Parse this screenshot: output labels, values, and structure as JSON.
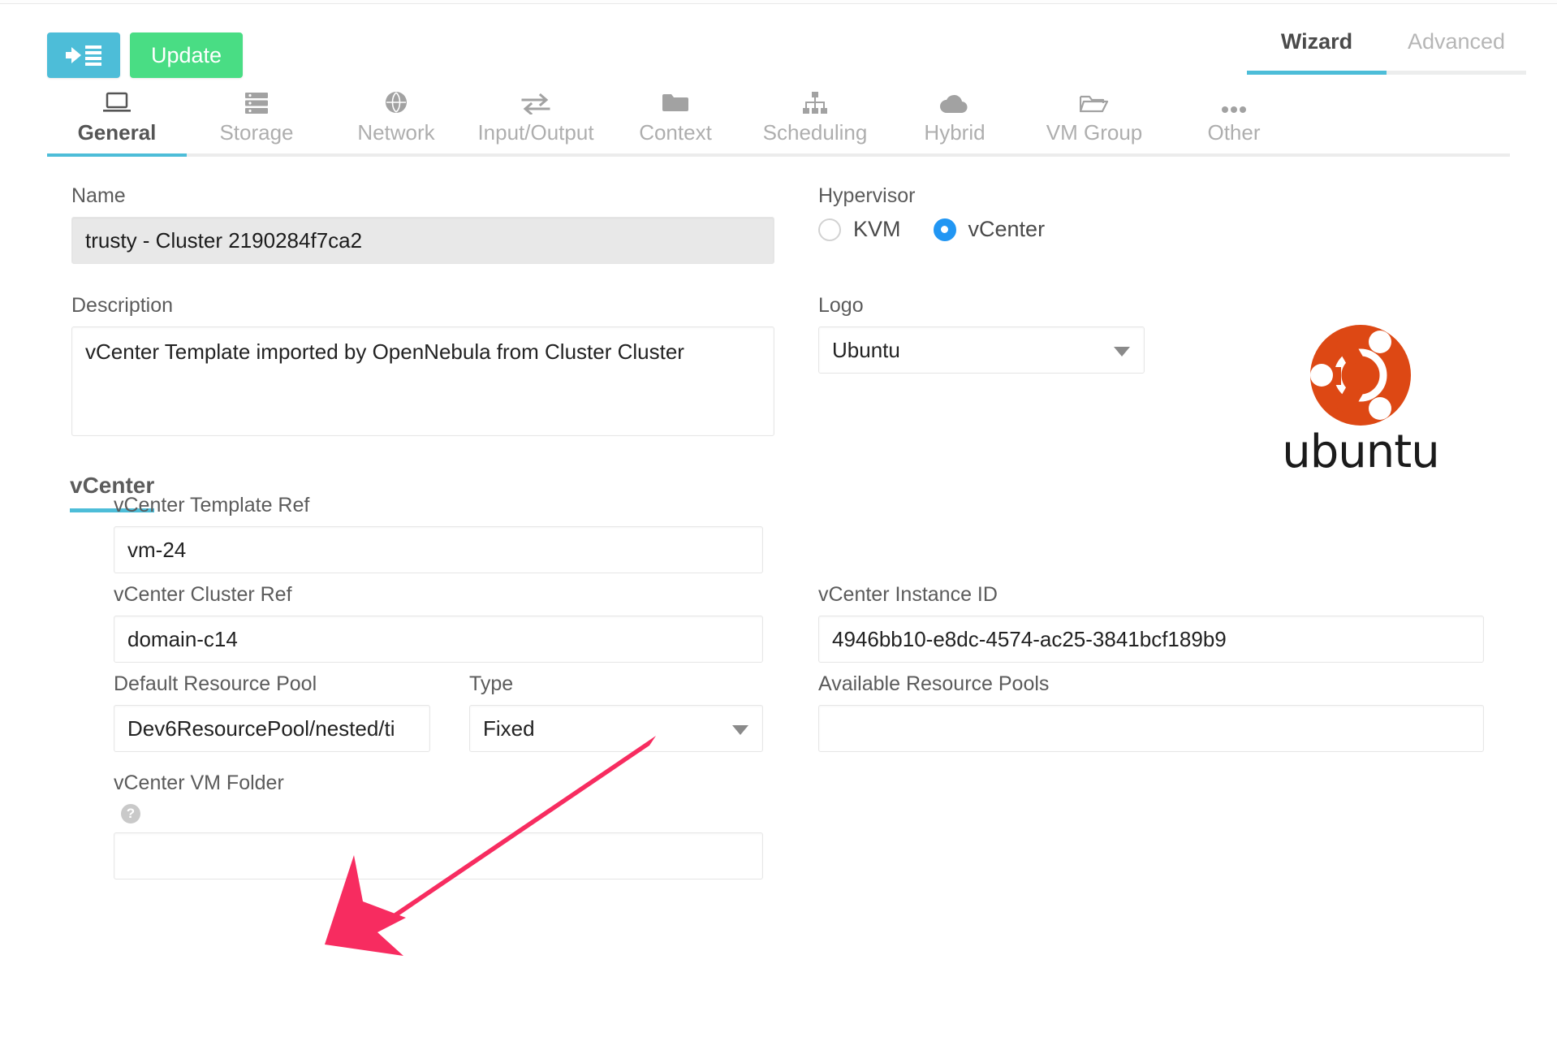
{
  "header": {
    "back_icon": "back-list-icon",
    "update_label": "Update",
    "back_color": "#4dbdd8",
    "update_color": "#49dd84"
  },
  "mode_tabs": [
    {
      "label": "Wizard",
      "active": true
    },
    {
      "label": "Advanced",
      "active": false
    }
  ],
  "tabs": [
    {
      "label": "General",
      "icon": "laptop-icon",
      "active": true
    },
    {
      "label": "Storage",
      "icon": "storage-icon",
      "active": false
    },
    {
      "label": "Network",
      "icon": "globe-icon",
      "active": false
    },
    {
      "label": "Input/Output",
      "icon": "exchange-icon",
      "active": false
    },
    {
      "label": "Context",
      "icon": "folder-icon",
      "active": false
    },
    {
      "label": "Scheduling",
      "icon": "sitemap-icon",
      "active": false
    },
    {
      "label": "Hybrid",
      "icon": "cloud-icon",
      "active": false
    },
    {
      "label": "VM Group",
      "icon": "folder-open-icon",
      "active": false
    },
    {
      "label": "Other",
      "icon": "ellipsis-icon",
      "active": false
    }
  ],
  "general": {
    "name_label": "Name",
    "name_value": "trusty - Cluster 2190284f7ca2",
    "description_label": "Description",
    "description_value": "vCenter Template imported by OpenNebula from Cluster Cluster",
    "hypervisor_label": "Hypervisor",
    "hypervisor_options": [
      {
        "label": "KVM",
        "selected": false
      },
      {
        "label": "vCenter",
        "selected": true
      }
    ],
    "logo_label": "Logo",
    "logo_value": "Ubuntu",
    "logo_image_alt": "ubuntu",
    "logo_wordmark": "ubuntu",
    "logo_color": "#dd4814"
  },
  "vcenter_section": {
    "title": "vCenter",
    "accent": "#4dbdd8",
    "fields": {
      "template_ref_label": "vCenter Template Ref",
      "template_ref_value": "vm-24",
      "cluster_ref_label": "vCenter Cluster Ref",
      "cluster_ref_value": "domain-c14",
      "instance_id_label": "vCenter Instance ID",
      "instance_id_value": "4946bb10-e8dc-4574-ac25-3841bcf189b9",
      "default_resource_pool_label": "Default Resource Pool",
      "default_resource_pool_value": "Dev6ResourcePool/nested/ti",
      "type_label": "Type",
      "type_value": "Fixed",
      "available_resource_pools_label": "Available Resource Pools",
      "available_resource_pools_value": "",
      "vm_folder_label": "vCenter VM Folder",
      "vm_folder_help": "?",
      "vm_folder_value": ""
    }
  },
  "annotation": {
    "arrow_color": "#f72c60",
    "arrow_name": "pink-annotation-arrow"
  }
}
